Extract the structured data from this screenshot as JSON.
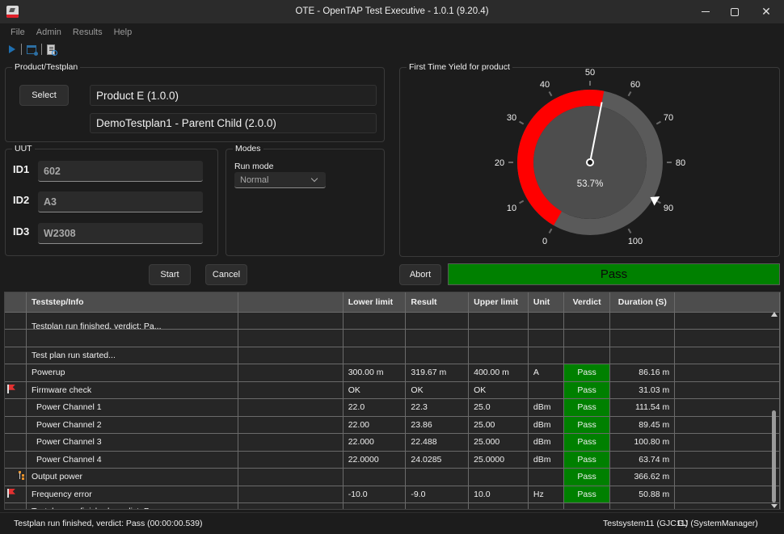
{
  "window": {
    "title": "OTE - OpenTAP Test Executive - 1.0.1  (9.20.4)",
    "controls": {
      "minimize": "minimize",
      "maximize": "maximize",
      "close": "close"
    }
  },
  "menu": {
    "items": [
      "File",
      "Admin",
      "Results",
      "Help"
    ]
  },
  "toolbar": {
    "icons": [
      "play-icon",
      "window-settings-icon",
      "report-search-icon"
    ]
  },
  "product_testplan": {
    "legend": "Product/Testplan",
    "select_label": "Select",
    "product": "Product E (1.0.0)",
    "testplan": "DemoTestplan1 - Parent Child (2.0.0)"
  },
  "uut": {
    "legend": "UUT",
    "fields": [
      {
        "label": "ID1",
        "value": "602"
      },
      {
        "label": "ID2",
        "value": "A3"
      },
      {
        "label": "ID3",
        "value": "W2308"
      }
    ]
  },
  "modes": {
    "legend": "Modes",
    "run_mode_label": "Run mode",
    "run_mode_value": "Normal"
  },
  "actions": {
    "start": "Start",
    "cancel": "Cancel",
    "abort": "Abort"
  },
  "yield": {
    "legend": "First Time Yield for product",
    "value_percent": 53.7,
    "display": "53.7%",
    "scale_min": 0,
    "scale_max": 100,
    "ticks": [
      "0",
      "10",
      "20",
      "30",
      "40",
      "50",
      "60",
      "70",
      "80",
      "90",
      "100"
    ],
    "red_range_end": 53.7,
    "marker_value": 90,
    "colors": {
      "red": "#ff0000",
      "track": "#5a5a5a",
      "face": "#4d4d4d"
    }
  },
  "verdict_banner": {
    "text": "Pass",
    "color": "#008000"
  },
  "grid": {
    "columns": [
      "",
      "Teststep/Info",
      "",
      "Lower limit",
      "Result",
      "Upper limit",
      "Unit",
      "Verdict",
      "Duration (S)",
      ""
    ],
    "partial_row_text": "Testplan run finished, verdict: Pa...",
    "rows": [
      {
        "icon": "",
        "step": "",
        "indent": false,
        "lower": "",
        "result": "",
        "upper": "",
        "unit": "",
        "verdict": "",
        "duration": ""
      },
      {
        "icon": "",
        "step": "Test plan run started...",
        "indent": false,
        "lower": "",
        "result": "",
        "upper": "",
        "unit": "",
        "verdict": "",
        "duration": ""
      },
      {
        "icon": "",
        "step": "Powerup",
        "indent": false,
        "lower": "300.00 m",
        "result": "319.67 m",
        "upper": "400.00 m",
        "unit": "A",
        "verdict": "Pass",
        "duration": "86.16 m"
      },
      {
        "icon": "flag-icon",
        "step": "Firmware check",
        "indent": false,
        "lower": "OK",
        "result": "OK",
        "upper": "OK",
        "unit": "",
        "verdict": "Pass",
        "duration": "31.03 m"
      },
      {
        "icon": "",
        "step": "Power Channel 1",
        "indent": true,
        "lower": "22.0",
        "result": "22.3",
        "upper": "25.0",
        "unit": "dBm",
        "verdict": "Pass",
        "duration": "111.54 m"
      },
      {
        "icon": "",
        "step": "Power Channel 2",
        "indent": true,
        "lower": "22.00",
        "result": "23.86",
        "upper": "25.00",
        "unit": "dBm",
        "verdict": "Pass",
        "duration": "89.45 m"
      },
      {
        "icon": "",
        "step": "Power Channel 3",
        "indent": true,
        "lower": "22.000",
        "result": "22.488",
        "upper": "25.000",
        "unit": "dBm",
        "verdict": "Pass",
        "duration": "100.80 m"
      },
      {
        "icon": "",
        "step": "Power Channel 4",
        "indent": true,
        "lower": "22.0000",
        "result": "24.0285",
        "upper": "25.0000",
        "unit": "dBm",
        "verdict": "Pass",
        "duration": "63.74 m"
      },
      {
        "icon": "tree-icon",
        "step": "Output power",
        "indent": false,
        "lower": "",
        "result": "",
        "upper": "",
        "unit": "",
        "verdict": "Pass",
        "duration": "366.62 m"
      },
      {
        "icon": "flag-icon",
        "step": "Frequency error",
        "indent": false,
        "lower": "-10.0",
        "result": "-9.0",
        "upper": "10.0",
        "unit": "Hz",
        "verdict": "Pass",
        "duration": "50.88 m"
      },
      {
        "icon": "",
        "step": "Testplan run finished, verdict: Pass",
        "indent": false,
        "lower": "",
        "result": "",
        "upper": "",
        "unit": "",
        "verdict": "",
        "duration": ""
      }
    ],
    "verdict_pass_color": "#008000"
  },
  "status": {
    "message": "Testplan run finished, verdict: Pass (00:00:00.539)",
    "system": "Testsystem11 (GJC11)",
    "user": "GJ (SystemManager)"
  }
}
